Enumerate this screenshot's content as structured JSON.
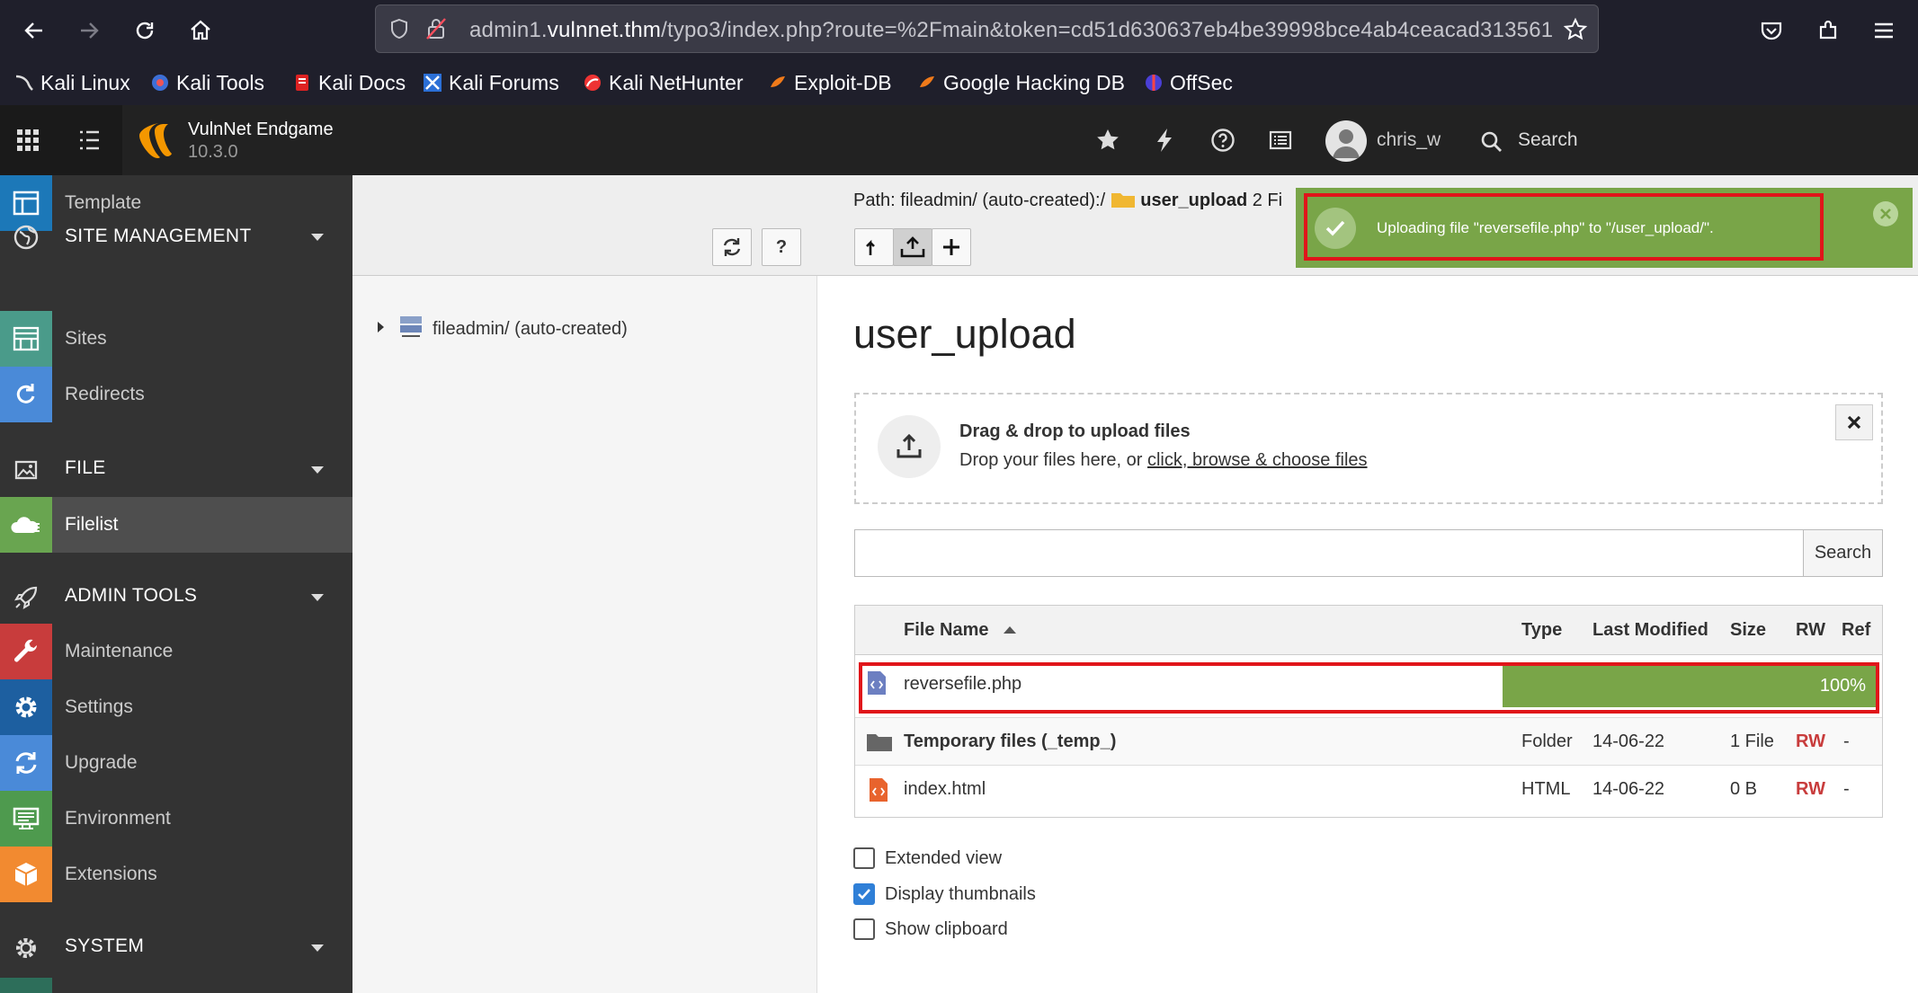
{
  "browser": {
    "url_prefix": "admin1.",
    "url_domain": "vulnnet.thm",
    "url_rest": "/typo3/index.php?route=%2Fmain&token=cd51d630637eb4be39998bce4ab4ceacad313561",
    "bookmarks": [
      "Kali Linux",
      "Kali Tools",
      "Kali Docs",
      "Kali Forums",
      "Kali NetHunter",
      "Exploit-DB",
      "Google Hacking DB",
      "OffSec"
    ]
  },
  "topbar": {
    "site_name": "VulnNet Endgame",
    "version": "10.3.0",
    "username": "chris_w",
    "search_label": "Search"
  },
  "sidebar": {
    "items": [
      {
        "label": "Template",
        "icon": "template-icon",
        "color": "#1c78b8"
      },
      {
        "label": "SITE MANAGEMENT",
        "icon": "globe-icon",
        "group": true
      },
      {
        "label": "Sites",
        "icon": "sites-icon",
        "color": "#4a9b8a"
      },
      {
        "label": "Redirects",
        "icon": "redirect-icon",
        "color": "#4a8ad8"
      },
      {
        "label": "FILE",
        "icon": "image-icon",
        "group": true
      },
      {
        "label": "Filelist",
        "icon": "filelist-icon",
        "color": "#69a550",
        "active": true
      },
      {
        "label": "ADMIN TOOLS",
        "icon": "rocket-icon",
        "group": true
      },
      {
        "label": "Maintenance",
        "icon": "wrench-icon",
        "color": "#c83c3c"
      },
      {
        "label": "Settings",
        "icon": "gear-icon",
        "color": "#1d5fa0"
      },
      {
        "label": "Upgrade",
        "icon": "refresh-icon",
        "color": "#4a8ad8"
      },
      {
        "label": "Environment",
        "icon": "environment-icon",
        "color": "#4e9a4e"
      },
      {
        "label": "Extensions",
        "icon": "box-icon",
        "color": "#f28a30"
      },
      {
        "label": "SYSTEM",
        "icon": "gear-icon",
        "group": true
      }
    ]
  },
  "tree": {
    "root_label": "fileadmin/ (auto-created)"
  },
  "main": {
    "path_prefix": "Path: fileadmin/ (auto-created):/",
    "path_folder": "user_upload",
    "path_suffix": "2 Fi",
    "heading": "user_upload",
    "dropzone_title": "Drag & drop to upload files",
    "dropzone_sub": "Drop your files here, or",
    "dropzone_link": "click, browse & choose files",
    "search_button": "Search",
    "table": {
      "headers": {
        "name": "File Name",
        "type": "Type",
        "modified": "Last Modified",
        "size": "Size",
        "rw": "RW",
        "ref": "Ref"
      },
      "upload_row": {
        "name": "reversefile.php",
        "progress": "100%",
        "progress_value": 100
      },
      "rows": [
        {
          "name": "Temporary files (_temp_)",
          "type": "Folder",
          "modified": "14-06-22",
          "size": "1 File",
          "rw": "RW",
          "ref": "-"
        },
        {
          "name": "index.html",
          "type": "HTML",
          "modified": "14-06-22",
          "size": "0 B",
          "rw": "RW",
          "ref": "-"
        }
      ]
    },
    "options": [
      {
        "label": "Extended view",
        "checked": false
      },
      {
        "label": "Display thumbnails",
        "checked": true
      },
      {
        "label": "Show clipboard",
        "checked": false
      }
    ]
  },
  "notification": {
    "message": "Uploading file \"reversefile.php\" to \"/user_upload/\"."
  }
}
